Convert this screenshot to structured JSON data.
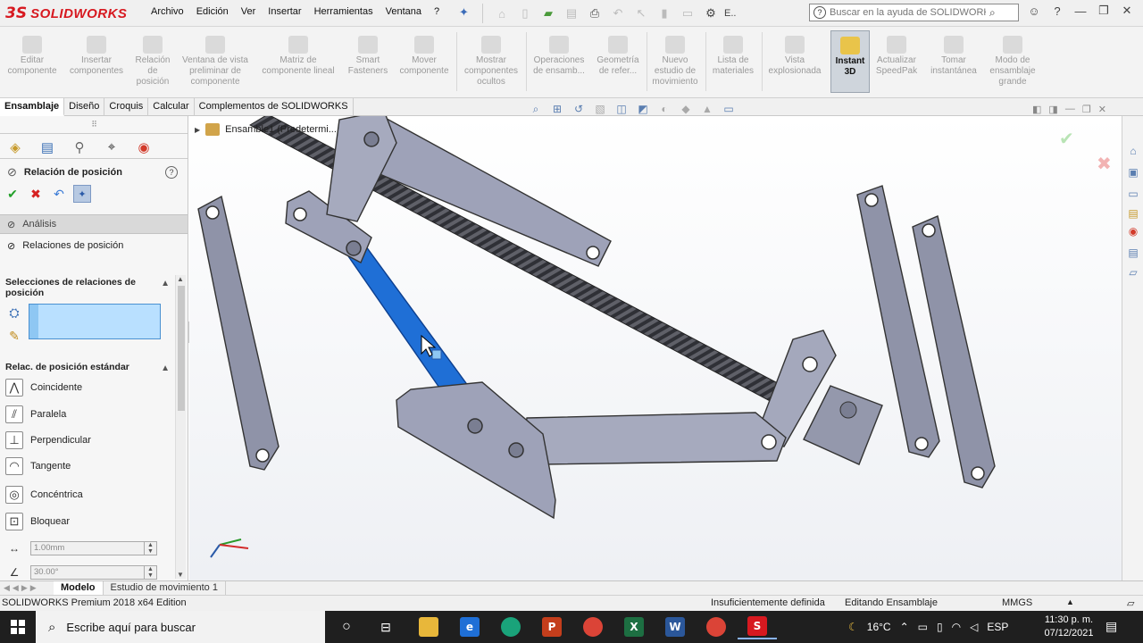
{
  "app": {
    "logo_ds": "3S",
    "logo_text": "SOLIDWORKS",
    "menu": [
      "Archivo",
      "Edición",
      "Ver",
      "Insertar",
      "Herramientas",
      "Ventana",
      "?"
    ],
    "menu_overflow": "E..",
    "search_placeholder": "Buscar en la ayuda de SOLIDWORKS"
  },
  "ribbon": {
    "buttons": [
      {
        "label": "Editar\ncomponente"
      },
      {
        "label": "Insertar\ncomponentes"
      },
      {
        "label": "Relación\nde\nposición"
      },
      {
        "label": "Ventana de vista\npreliminar de\ncomponente"
      },
      {
        "label": "Matriz de\ncomponente lineal"
      },
      {
        "label": "Smart\nFasteners"
      },
      {
        "label": "Mover\ncomponente"
      },
      {
        "label": "Mostrar\ncomponentes\nocultos"
      },
      {
        "label": "Operaciones\nde ensamb..."
      },
      {
        "label": "Geometría\nde refer..."
      },
      {
        "label": "Nuevo\nestudio de\nmovimiento"
      },
      {
        "label": "Lista de\nmateriales"
      },
      {
        "label": "Vista\nexplosionada"
      },
      {
        "label": "Instant\n3D"
      },
      {
        "label": "Actualizar\nSpeedPak"
      },
      {
        "label": "Tomar\ninstantánea"
      },
      {
        "label": "Modo de\nensamblaje\ngrande"
      }
    ]
  },
  "tabs": [
    "Ensamblaje",
    "Diseño",
    "Croquis",
    "Calcular",
    "Complementos de SOLIDWORKS"
  ],
  "tree_flyout": {
    "label": "Ensamble1 (Predetermi..."
  },
  "property_manager": {
    "title": "Relación de posición",
    "tab_analysis": "Análisis",
    "tab_mates": "Relaciones de posición",
    "selections_header": "Selecciones de relaciones de posición",
    "standard_header": "Relac. de posición estándar",
    "mates": [
      {
        "label": "Coincidente",
        "icon": "coincident-icon"
      },
      {
        "label": "Paralela",
        "icon": "parallel-icon"
      },
      {
        "label": "Perpendicular",
        "icon": "perpendicular-icon"
      },
      {
        "label": "Tangente",
        "icon": "tangent-icon"
      },
      {
        "label": "Concéntrica",
        "icon": "concentric-icon"
      },
      {
        "label": "Bloquear",
        "icon": "lock-icon"
      }
    ],
    "distance_value": "1.00mm",
    "angle_value": "30.00°"
  },
  "bottom_tabs": [
    "Modelo",
    "Estudio de movimiento 1"
  ],
  "status": {
    "edition": "SOLIDWORKS Premium 2018 x64 Edition",
    "definition": "Insuficientemente definida",
    "mode": "Editando Ensamblaje",
    "units": "MMGS"
  },
  "taskbar": {
    "search_placeholder": "Escribe aquí para buscar",
    "weather": "16°C",
    "lang": "ESP",
    "time": "11:30 p. m.",
    "date": "07/12/2021"
  },
  "colors": {
    "part_fill": "#8f93a8",
    "part_edge": "#3a3c4a",
    "selected_part": "#1f6fd6",
    "accent_red": "#d71920"
  }
}
